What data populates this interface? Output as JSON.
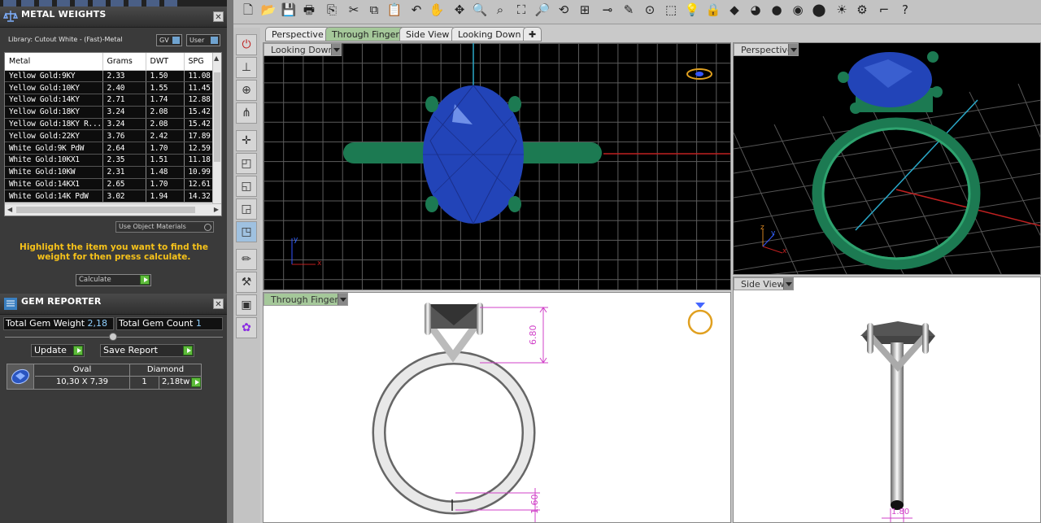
{
  "metal_weights": {
    "title": "METAL WEIGHTS",
    "library": "Library: Cutout White - (Fast)-Metal",
    "gv_label": "GV",
    "user_label": "User",
    "columns": [
      "Metal",
      "Grams",
      "DWT",
      "SPG"
    ],
    "rows": [
      [
        "Yellow Gold:9KY",
        "2.33",
        "1.50",
        "11.08"
      ],
      [
        "Yellow Gold:10KY",
        "2.40",
        "1.55",
        "11.45"
      ],
      [
        "Yellow Gold:14KY",
        "2.71",
        "1.74",
        "12.88"
      ],
      [
        "Yellow Gold:18KY",
        "3.24",
        "2.08",
        "15.42"
      ],
      [
        "Yellow Gold:18KY R...",
        "3.24",
        "2.08",
        "15.42"
      ],
      [
        "Yellow Gold:22KY",
        "3.76",
        "2.42",
        "17.89"
      ],
      [
        "White Gold:9K PdW",
        "2.64",
        "1.70",
        "12.59"
      ],
      [
        "White Gold:10KX1",
        "2.35",
        "1.51",
        "11.18"
      ],
      [
        "White Gold:10KW",
        "2.31",
        "1.48",
        "10.99"
      ],
      [
        "White Gold:14KX1",
        "2.65",
        "1.70",
        "12.61"
      ],
      [
        "White Gold:14K PdW",
        "3.02",
        "1.94",
        "14.32"
      ]
    ],
    "use_object_materials": "Use Object Materials",
    "hint": "Highlight the item you want to find the weight for then press calculate.",
    "calculate_label": "Calculate"
  },
  "gem_reporter": {
    "title": "GEM REPORTER",
    "total_weight_label": "Total Gem Weight",
    "total_weight_value": "2,18",
    "total_count_label": "Total Gem Count",
    "total_count_value": "1",
    "update_label": "Update",
    "save_report_label": "Save Report",
    "gem": {
      "shape": "Oval",
      "material": "Diamond",
      "size": "10,30 X 7,39",
      "count": "1",
      "weight": "2,18tw"
    }
  },
  "tabs": [
    "Perspective",
    "Through Finger",
    "Side View",
    "Looking Down"
  ],
  "viewports": {
    "looking_down": "Looking Down",
    "perspective": "Perspective",
    "through_finger": "Through Finger",
    "side_view": "Side View"
  },
  "dimensions": {
    "height_a": "6.80",
    "height_b": "1.60",
    "width": "1.80"
  },
  "axes": {
    "y": "y",
    "x": "x",
    "z": "z"
  },
  "colors": {
    "gem": "#2244b8",
    "band_green": "#1c7a52",
    "dim_line": "#d040c8",
    "hint": "#f6c21a",
    "active_tab": "#a5c89a"
  }
}
